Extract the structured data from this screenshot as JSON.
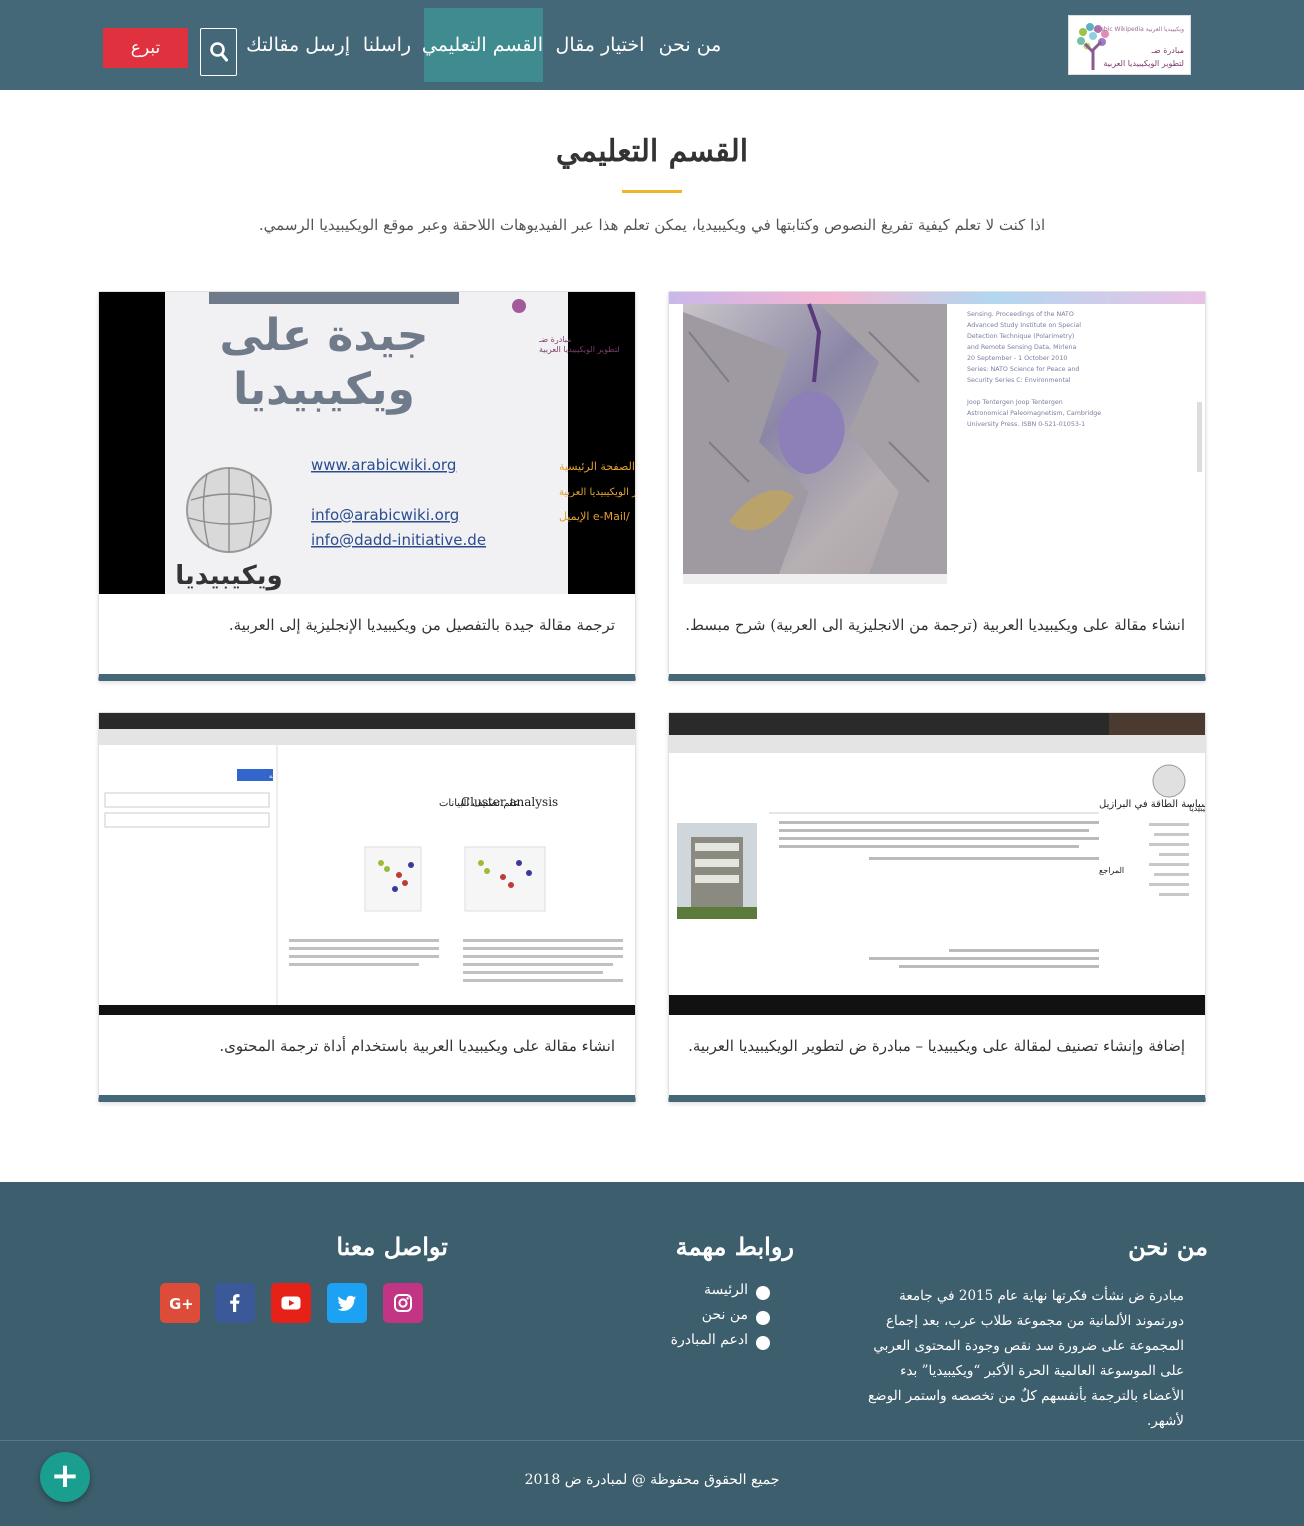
{
  "header": {
    "logo": {
      "line1": "ويكيبيديا العربية Arabic Wikipedia",
      "line2": "مبادرة ضـ",
      "line3": "لتطوير الويكيبيديا العربية"
    },
    "nav": [
      {
        "label": "من نحن",
        "active": false
      },
      {
        "label": "اختيار مقال",
        "active": false
      },
      {
        "label": "القسم التعليمي",
        "active": true
      },
      {
        "label": "راسلنا",
        "active": false
      },
      {
        "label": "إرسل مقالتك",
        "active": false
      }
    ],
    "search_icon": "search-icon",
    "donate_label": "تبرع",
    "colors": {
      "bar": "#456878",
      "active": "#3f8b8f",
      "donate": "#e0313f"
    }
  },
  "section": {
    "title": "القسم التعليمي",
    "intro": "اذا كنت لا تعلم كيفية تفريغ النصوص وكتابتها في ويكيبيديا، يمكن تعلم هذا عبر الفيديوهات اللاحقة وعبر موقع الويكيبيديا الرسمي."
  },
  "videos": [
    {
      "caption": "انشاء مقالة على ويكيبيديا العربية (ترجمة من الانجليزية الى العربية) شرح مبسط.",
      "thumb_text": [
        "Sensing. Proceedings of the NATO",
        "Advanced Study Institute on Special",
        "Detection Technique (Polarimetry)",
        "and Remote Sensing Data, Mirlena",
        "20 September - 1 October 2010",
        "Series: NATO Science for Peace and",
        "Security Series C: Environmental",
        "Joop Tentergen Joop Tentergen",
        "Astronomical Paleomagnetism, Cambridge",
        "University Press. ISBN 0-521-01053-1"
      ]
    },
    {
      "caption": "ترجمة مقالة جيدة بالتفصيل من ويكيبيديا الإنجليزية إلى العربية.",
      "thumb_text": {
        "big1": "جيدة على",
        "big2": "ويكيبيديا",
        "org1": "مبادرة ضـ",
        "org2": "لتطوير الويكيبيديا العربية",
        "url1": "www.arabicwiki.org",
        "url1_label": "الصفحة الرئيسية",
        "fb_label": "الفيسبوك: مبادرة ضـ لتطوير الويكيبيديا العربية",
        "mail1": "info@arabicwiki.org",
        "mail1_label": "/e-Mail الإيميل",
        "mail2": "info@dadd-initiative.de",
        "wiki_word": "ويكيبيديا"
      }
    },
    {
      "caption": "إضافة وإنشاء تصنيف لمقالة على ويكيبيديا – مبادرة ض لتطوير الويكيبيديا العربية.",
      "thumb_text": {
        "heading": "سياسة الطاقة في البرازيل",
        "wiki": "ويكيبيديا",
        "refs": "المراجع"
      }
    },
    {
      "caption": "انشاء مقالة على ويكيبيديا العربية باستخدام أداة ترجمة المحتوى.",
      "thumb_text": {
        "left_title": "Cluster analysis",
        "right_title": "علم تصنيف البيانات",
        "button": "نشر الترجمة"
      }
    }
  ],
  "footer": {
    "about": {
      "title": "من نحن",
      "text": "مبادرة ض نشأت فكرتها نهاية عام 2015 في جامعة دورتموند الألمانية من مجموعة طلاب عرب، بعد إجماع المجموعة على ضرورة سد نقص وجودة المحتوى العربي على الموسوعة العالمية الحرة الأكبر “ويكيبيديا” بدء الأعضاء بالترجمة بأنفسهم كلٌ من تخصصه واستمر الوضع لأشهر."
    },
    "links": {
      "title": "روابط مهمة",
      "items": [
        "الرئيسة",
        "من نحن",
        "ادعم المبادرة"
      ]
    },
    "contact": {
      "title": "تواصل معنا",
      "social": [
        {
          "icon": "instagram-icon",
          "color": "#c13584"
        },
        {
          "icon": "twitter-icon",
          "color": "#1da1f2"
        },
        {
          "icon": "youtube-icon",
          "color": "#e62117"
        },
        {
          "icon": "facebook-icon",
          "color": "#3b5998"
        },
        {
          "icon": "google-plus-icon",
          "color": "#dd4b39"
        }
      ]
    },
    "copyright": "جميع الحقوق محفوظة @ لمبادرة ض 2018",
    "colors": {
      "bg": "#3d5e6c"
    }
  },
  "fab": {
    "icon": "plus-icon",
    "color": "#1a9e90"
  }
}
